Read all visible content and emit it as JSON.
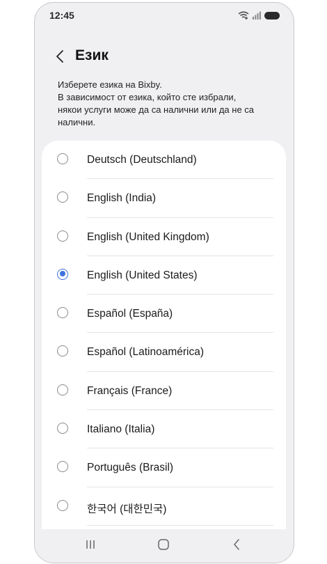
{
  "status_bar": {
    "time": "12:45"
  },
  "header": {
    "title": "Език"
  },
  "description": {
    "line1": "Изберете езика на Bixby.",
    "line2": "В зависимост от езика, който сте избрали,",
    "line3": "някои услуги може да са налични или да не са",
    "line4": "налични."
  },
  "languages": [
    {
      "label": "Deutsch (Deutschland)",
      "selected": false
    },
    {
      "label": "English (India)",
      "selected": false
    },
    {
      "label": "English (United Kingdom)",
      "selected": false
    },
    {
      "label": "English (United States)",
      "selected": true
    },
    {
      "label": "Español (España)",
      "selected": false
    },
    {
      "label": "Español (Latinoamérica)",
      "selected": false
    },
    {
      "label": "Français (France)",
      "selected": false
    },
    {
      "label": "Italiano (Italia)",
      "selected": false
    },
    {
      "label": "Português (Brasil)",
      "selected": false
    },
    {
      "label": "한국어 (대한민국)",
      "selected": false
    }
  ],
  "colors": {
    "accent": "#3d74e0",
    "background": "#f0f0f2",
    "card": "#ffffff"
  },
  "icons": {
    "back": "chevron-left-icon",
    "wifi": "wifi-icon",
    "signal": "signal-icon",
    "battery": "battery-icon",
    "recents": "recents-icon",
    "home": "home-icon",
    "nav_back": "nav-back-icon"
  }
}
